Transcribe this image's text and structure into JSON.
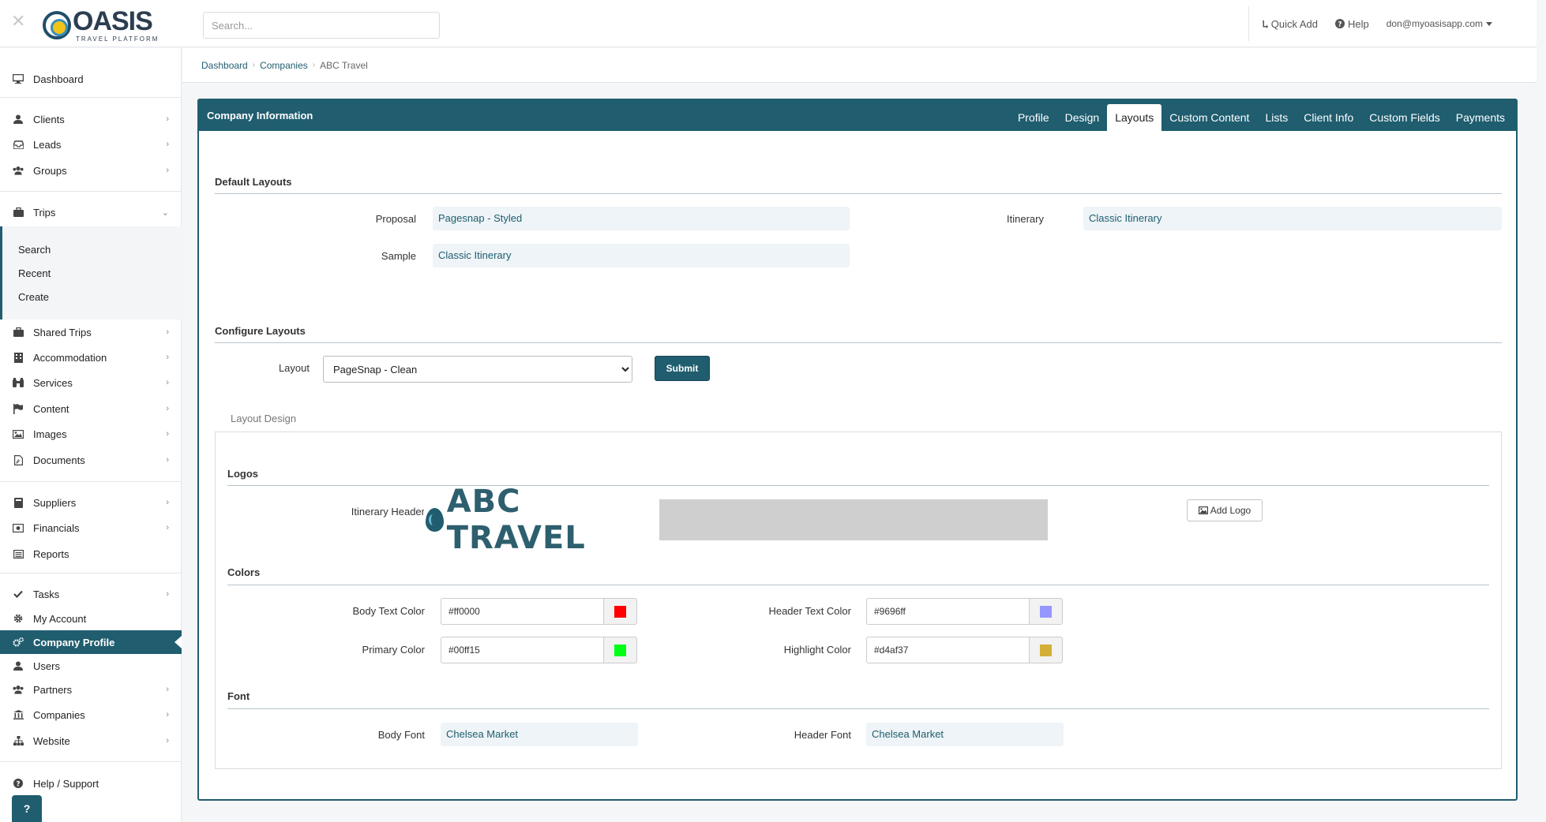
{
  "topbar": {
    "logo_word": "OASIS",
    "logo_sub": "TRAVEL PLATFORM",
    "search_placeholder": "Search...",
    "quick_add": "Quick Add",
    "help": "Help",
    "user": "don@myoasisapp.com"
  },
  "sidebar": {
    "dashboard": "Dashboard",
    "clients": "Clients",
    "leads": "Leads",
    "groups": "Groups",
    "trips": "Trips",
    "trips_search": "Search",
    "trips_recent": "Recent",
    "trips_create": "Create",
    "shared_trips": "Shared Trips",
    "accommodation": "Accommodation",
    "services": "Services",
    "content": "Content",
    "images": "Images",
    "documents": "Documents",
    "suppliers": "Suppliers",
    "financials": "Financials",
    "reports": "Reports",
    "tasks": "Tasks",
    "my_account": "My Account",
    "company_profile": "Company Profile",
    "users": "Users",
    "partners": "Partners",
    "companies": "Companies",
    "website": "Website",
    "help_support": "Help / Support",
    "help_fab": "?"
  },
  "breadcrumb": {
    "dashboard": "Dashboard",
    "companies": "Companies",
    "current": "ABC Travel"
  },
  "panel": {
    "title": "Company Information",
    "tabs": [
      "Profile",
      "Design",
      "Layouts",
      "Custom Content",
      "Lists",
      "Client Info",
      "Custom Fields",
      "Payments"
    ],
    "active_tab": "Layouts"
  },
  "default_layouts": {
    "title": "Default Layouts",
    "proposal_label": "Proposal",
    "proposal_value": "Pagesnap - Styled",
    "sample_label": "Sample",
    "sample_value": "Classic Itinerary",
    "itinerary_label": "Itinerary",
    "itinerary_value": "Classic Itinerary"
  },
  "configure_layouts": {
    "title": "Configure Layouts",
    "layout_label": "Layout",
    "layout_selected": "PageSnap - Clean",
    "submit": "Submit"
  },
  "layout_design": {
    "legend": "Layout Design",
    "logos_title": "Logos",
    "itinerary_header_label": "Itinerary Header",
    "logo_text": "ABC TRAVEL",
    "add_logo": "Add Logo",
    "colors_title": "Colors",
    "body_text_color_label": "Body Text Color",
    "body_text_color": "#ff0000",
    "header_text_color_label": "Header Text Color",
    "header_text_color": "#9696ff",
    "primary_color_label": "Primary Color",
    "primary_color": "#00ff15",
    "highlight_color_label": "Highlight Color",
    "highlight_color": "#d4af37",
    "font_title": "Font",
    "body_font_label": "Body Font",
    "body_font": "Chelsea Market",
    "header_font_label": "Header Font",
    "header_font": "Chelsea Market"
  },
  "colors": {
    "brand": "#1f5d6f"
  }
}
